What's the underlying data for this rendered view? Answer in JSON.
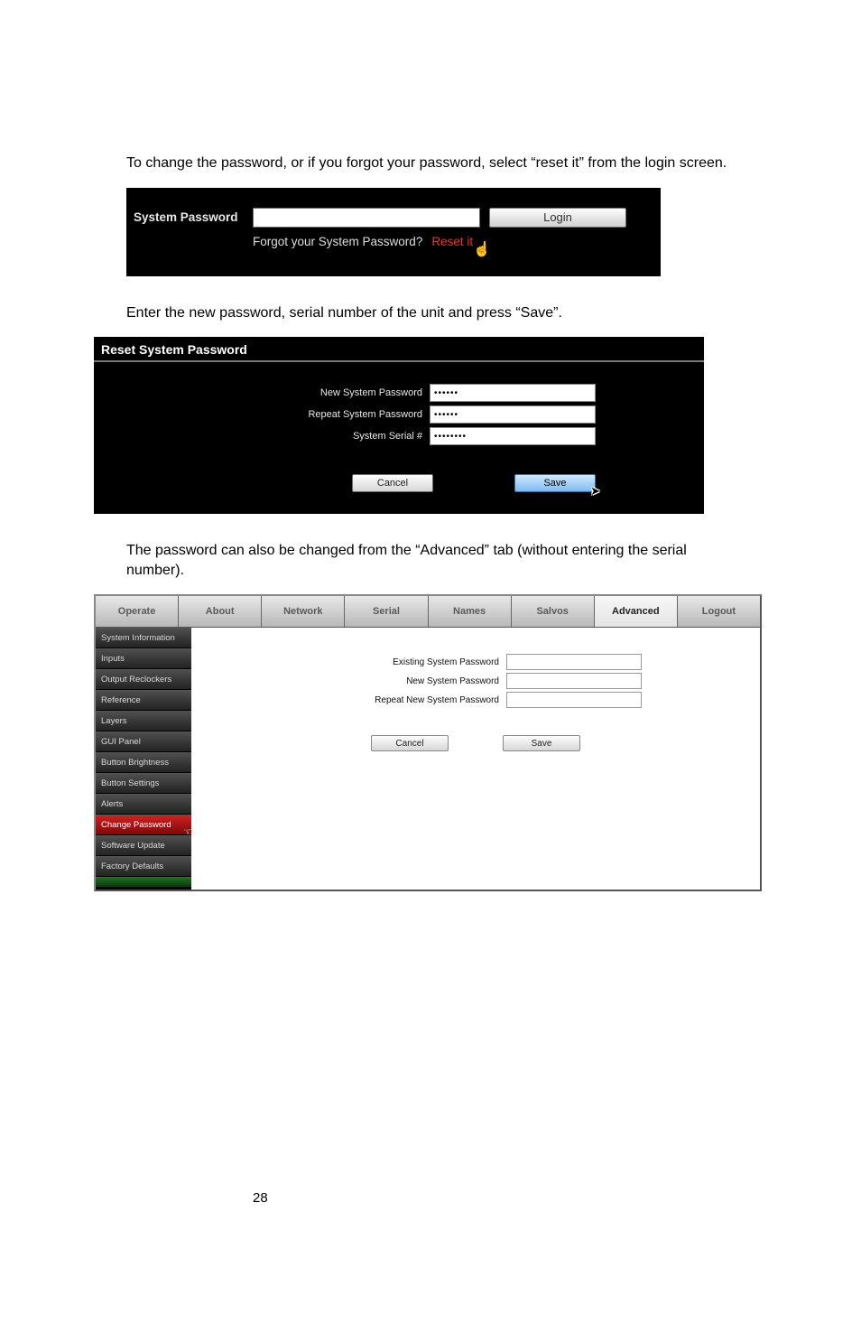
{
  "intro1": "To change the password, or if you forgot your password, select “reset it” from the login screen.",
  "login": {
    "label": "System Password",
    "button": "Login",
    "forgot_text": "Forgot your System Password?",
    "reset_link": "Reset it"
  },
  "intro2": "Enter the new password, serial number of the unit and press “Save”.",
  "reset": {
    "title": "Reset System Password",
    "rows": [
      {
        "label": "New System Password",
        "value": "••••••"
      },
      {
        "label": "Repeat System Password",
        "value": "••••••"
      },
      {
        "label": "System Serial #",
        "value": "••••••••"
      }
    ],
    "cancel": "Cancel",
    "save": "Save"
  },
  "intro3": "The password can also be changed from the “Advanced” tab (without entering the serial number).",
  "adv": {
    "tabs": [
      "Operate",
      "About",
      "Network",
      "Serial",
      "Names",
      "Salvos",
      "Advanced",
      "Logout"
    ],
    "active_tab": 6,
    "sidebar": [
      "System Information",
      "Inputs",
      "Output Reclockers",
      "Reference",
      "Layers",
      "GUI Panel",
      "Button Brightness",
      "Button Settings",
      "Alerts",
      "Change Password",
      "Software Update",
      "Factory Defaults"
    ],
    "active_sidebar": 9,
    "fields": [
      "Existing System Password",
      "New System Password",
      "Repeat New System Password"
    ],
    "cancel": "Cancel",
    "save": "Save"
  },
  "page_number": "28"
}
